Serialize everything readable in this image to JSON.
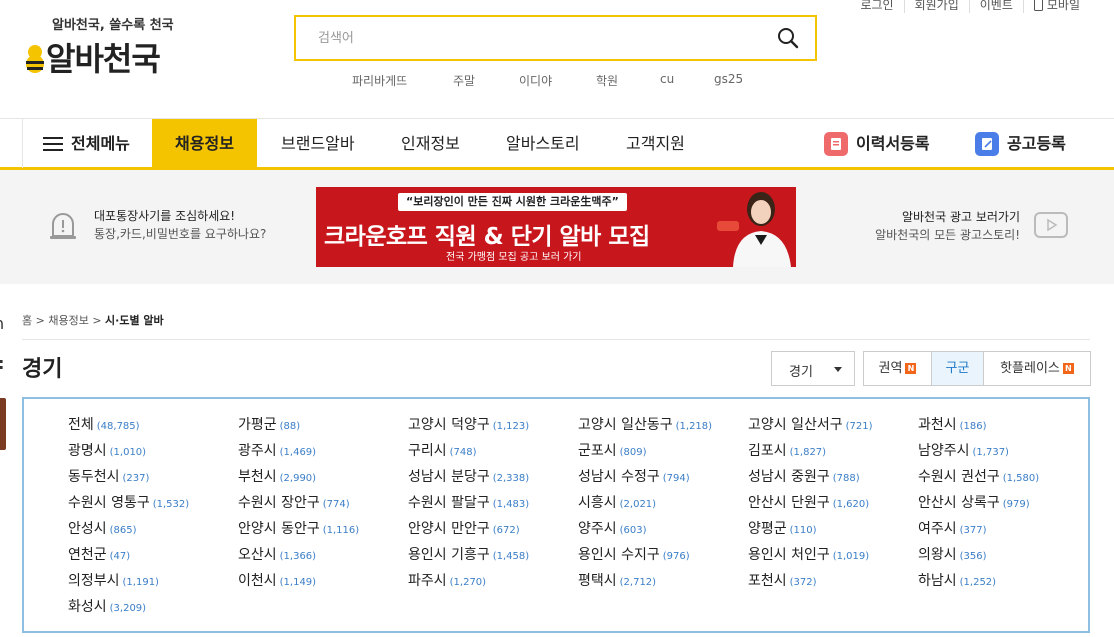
{
  "header": {
    "logo_tagline": "알바천국, 쓸수록 천국",
    "logo_text": "알바천국",
    "search_placeholder": "검색어",
    "keywords": [
      "파리바게뜨",
      "주말",
      "이디야",
      "학원",
      "cu",
      "gs25"
    ],
    "util_links": [
      "로그인",
      "회원가입",
      "이벤트",
      "모바일"
    ]
  },
  "nav": {
    "all_menu": "전체메뉴",
    "items": [
      "채용정보",
      "브랜드알바",
      "인재정보",
      "알바스토리",
      "고객지원"
    ],
    "resume_register": "이력서등록",
    "job_register": "공고등록"
  },
  "strip": {
    "warn_title": "대포통장사기를 조심하세요!",
    "warn_sub": "통장,카드,비밀번호를 요구하나요?",
    "ad_quote": "“보리장인이 만든 진짜 시원한 크라운生맥주”",
    "ad_main": "크라운호프 직원 & 단기 알바 모집",
    "ad_sub": "전국 가맹점 모집 공고 보러 가기",
    "ad_link_title": "알바천국 광고 보러가기",
    "ad_link_sub": "알바천국의 모든 광고스토리!"
  },
  "breadcrumb": {
    "home": "홈",
    "sep": ">",
    "level1": "채용정보",
    "current": "시·도별 알바"
  },
  "page": {
    "title": "경기",
    "region_value": "경기",
    "tabs": [
      "권역",
      "구군",
      "핫플레이스"
    ],
    "tab_new_badge": "N"
  },
  "regions": [
    {
      "name": "전체",
      "count": "(48,785)"
    },
    {
      "name": "가평군",
      "count": "(88)"
    },
    {
      "name": "고양시 덕양구",
      "count": "(1,123)"
    },
    {
      "name": "고양시 일산동구",
      "count": "(1,218)"
    },
    {
      "name": "고양시 일산서구",
      "count": "(721)"
    },
    {
      "name": "과천시",
      "count": "(186)"
    },
    {
      "name": "광명시",
      "count": "(1,010)"
    },
    {
      "name": "광주시",
      "count": "(1,469)"
    },
    {
      "name": "구리시",
      "count": "(748)"
    },
    {
      "name": "군포시",
      "count": "(809)"
    },
    {
      "name": "김포시",
      "count": "(1,827)"
    },
    {
      "name": "남양주시",
      "count": "(1,737)"
    },
    {
      "name": "동두천시",
      "count": "(237)"
    },
    {
      "name": "부천시",
      "count": "(2,990)"
    },
    {
      "name": "성남시 분당구",
      "count": "(2,338)"
    },
    {
      "name": "성남시 수정구",
      "count": "(794)"
    },
    {
      "name": "성남시 중원구",
      "count": "(788)"
    },
    {
      "name": "수원시 권선구",
      "count": "(1,580)"
    },
    {
      "name": "수원시 영통구",
      "count": "(1,532)"
    },
    {
      "name": "수원시 장안구",
      "count": "(774)"
    },
    {
      "name": "수원시 팔달구",
      "count": "(1,483)"
    },
    {
      "name": "시흥시",
      "count": "(2,021)"
    },
    {
      "name": "안산시 단원구",
      "count": "(1,620)"
    },
    {
      "name": "안산시 상록구",
      "count": "(979)"
    },
    {
      "name": "안성시",
      "count": "(865)"
    },
    {
      "name": "안양시 동안구",
      "count": "(1,116)"
    },
    {
      "name": "안양시 만안구",
      "count": "(672)"
    },
    {
      "name": "양주시",
      "count": "(603)"
    },
    {
      "name": "양평군",
      "count": "(110)"
    },
    {
      "name": "여주시",
      "count": "(377)"
    },
    {
      "name": "연천군",
      "count": "(47)"
    },
    {
      "name": "오산시",
      "count": "(1,366)"
    },
    {
      "name": "용인시 기흥구",
      "count": "(1,458)"
    },
    {
      "name": "용인시 수지구",
      "count": "(976)"
    },
    {
      "name": "용인시 처인구",
      "count": "(1,019)"
    },
    {
      "name": "의왕시",
      "count": "(356)"
    },
    {
      "name": "의정부시",
      "count": "(1,191)"
    },
    {
      "name": "이천시",
      "count": "(1,149)"
    },
    {
      "name": "파주시",
      "count": "(1,270)"
    },
    {
      "name": "평택시",
      "count": "(2,712)"
    },
    {
      "name": "포천시",
      "count": "(372)"
    },
    {
      "name": "하남시",
      "count": "(1,252)"
    },
    {
      "name": "화성시",
      "count": "(3,209)"
    }
  ],
  "colors": {
    "brand_yellow": "#f5c400",
    "ad_red": "#c8161d",
    "count_blue": "#3b7ec7",
    "grid_border": "#8ebfe0",
    "active_tab": "#1f78c7"
  }
}
